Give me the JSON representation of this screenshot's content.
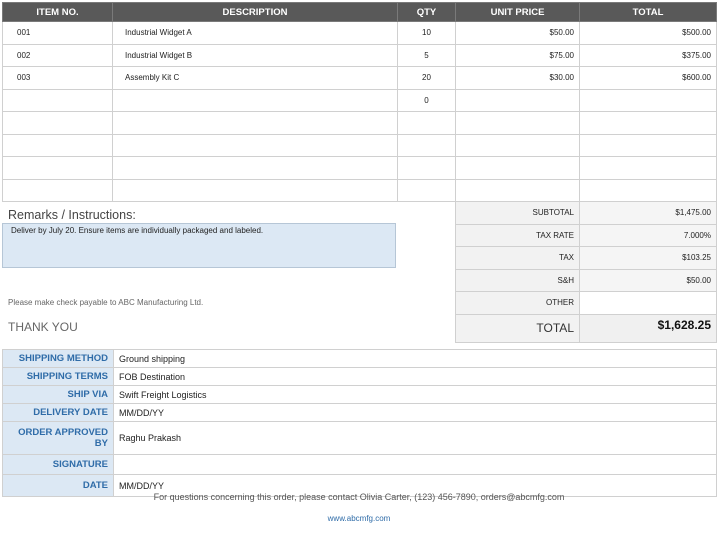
{
  "items_table": {
    "headers": [
      "ITEM NO.",
      "DESCRIPTION",
      "QTY",
      "UNIT PRICE",
      "TOTAL"
    ],
    "rows": [
      {
        "item_no": "001",
        "description": "Industrial Widget A",
        "qty": "10",
        "unit_price": "$50.00",
        "total": "$500.00"
      },
      {
        "item_no": "002",
        "description": "Industrial Widget B",
        "qty": "5",
        "unit_price": "$75.00",
        "total": "$375.00"
      },
      {
        "item_no": "003",
        "description": "Assembly Kit C",
        "qty": "20",
        "unit_price": "$30.00",
        "total": "$600.00"
      },
      {
        "item_no": "",
        "description": "",
        "qty": "0",
        "unit_price": "",
        "total": ""
      },
      {
        "item_no": "",
        "description": "",
        "qty": "",
        "unit_price": "",
        "total": ""
      },
      {
        "item_no": "",
        "description": "",
        "qty": "",
        "unit_price": "",
        "total": ""
      },
      {
        "item_no": "",
        "description": "",
        "qty": "",
        "unit_price": "",
        "total": ""
      },
      {
        "item_no": "",
        "description": "",
        "qty": "",
        "unit_price": "",
        "total": ""
      }
    ]
  },
  "remarks": {
    "label": "Remarks / Instructions:",
    "text": "Deliver by July 20. Ensure items are individually packaged and labeled."
  },
  "check_note": "Please make check payable to ABC Manufacturing Ltd.",
  "thank_you": "THANK YOU",
  "totals": {
    "subtotal_label": "SUBTOTAL",
    "subtotal": "$1,475.00",
    "tax_rate_label": "TAX RATE",
    "tax_rate": "7.000%",
    "tax_label": "TAX",
    "tax": "$103.25",
    "sh_label": "S&H",
    "sh": "$50.00",
    "other_label": "OTHER",
    "other": "",
    "total_label": "TOTAL",
    "total": "$1,628.25"
  },
  "shipping": {
    "method_label": "SHIPPING METHOD",
    "method": "Ground shipping",
    "terms_label": "SHIPPING TERMS",
    "terms": "FOB Destination",
    "via_label": "SHIP VIA",
    "via": "Swift Freight Logistics",
    "delivery_label": "DELIVERY DATE",
    "delivery": "MM/DD/YY",
    "approved_label": "ORDER APPROVED BY",
    "approved": "Raghu Prakash",
    "signature_label": "SIGNATURE",
    "signature": "",
    "date_label": "DATE",
    "date": "MM/DD/YY"
  },
  "footer": {
    "contact": "For questions concerning this order, please contact Olivia Carter, (123) 456-7890, orders@abcmfg.com",
    "website": "www.abcmfg.com"
  }
}
